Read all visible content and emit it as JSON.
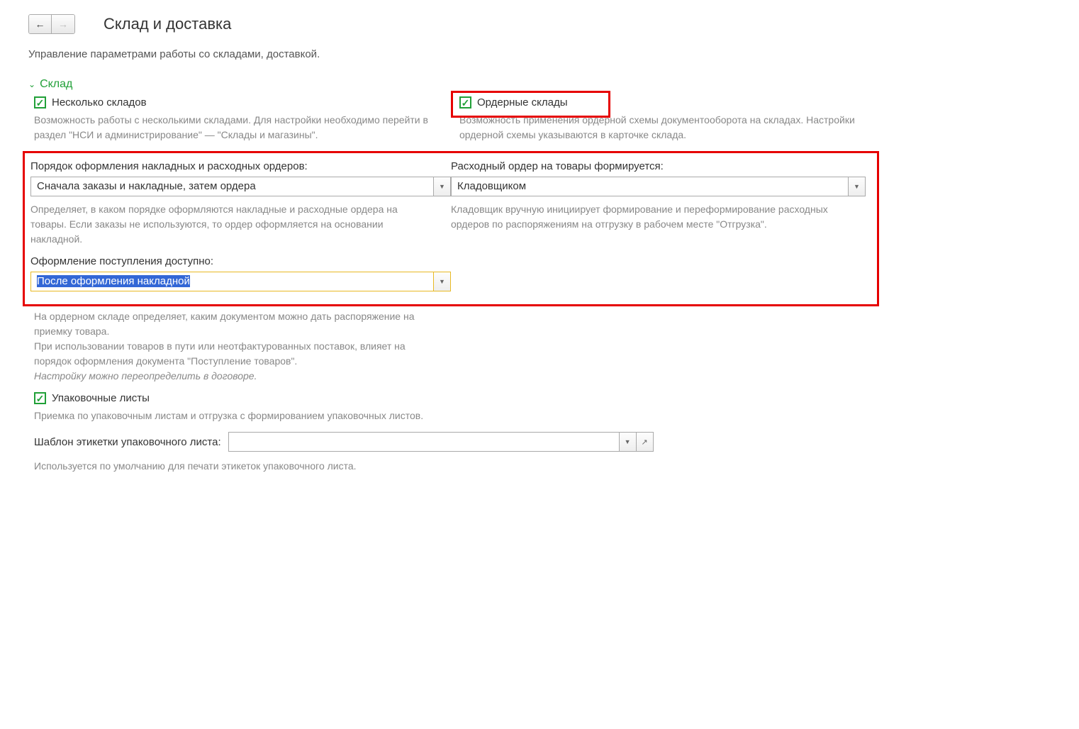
{
  "header": {
    "title": "Склад и доставка"
  },
  "subtitle": "Управление параметрами работы со складами, доставкой.",
  "section": {
    "title": "Склад"
  },
  "left": {
    "multiple_warehouses_label": "Несколько складов",
    "multiple_warehouses_desc": "Возможность работы с несколькими складами. Для настройки необходимо перейти в раздел \"НСИ и администрирование\" — \"Склады и магазины\"."
  },
  "right": {
    "order_warehouses_label": "Ордерные склады",
    "order_warehouses_desc": "Возможность применения ордерной схемы документооборота на складах. Настройки ордерной схемы указываются в карточке склада."
  },
  "block": {
    "field1_label": "Порядок оформления накладных и расходных ордеров:",
    "field1_value": "Сначала заказы и накладные, затем ордера",
    "field1_desc": "Определяет, в каком порядке оформляются накладные и расходные ордера на товары. Если заказы не используются, то ордер оформляется на основании накладной.",
    "field2_label": "Расходный ордер на товары формируется:",
    "field2_value": "Кладовщиком",
    "field2_desc": "Кладовщик вручную инициирует формирование и переформирование расходных ордеров по распоряжениям на отгрузку в рабочем месте \"Отгрузка\".",
    "field3_label": "Оформление поступления доступно:",
    "field3_value": "После оформления накладной"
  },
  "below": {
    "desc1": "На ордерном складе определяет, каким документом можно дать распоряжение на приемку товара.",
    "desc2": "При использовании товаров в пути или неотфактурованных поставок, влияет на порядок оформления документа \"Поступление товаров\".",
    "desc3_italic": "Настройку можно переопределить в договоре.",
    "packing_lists_label": "Упаковочные листы",
    "packing_lists_desc": "Приемка по упаковочным листам и отгрузка с формированием упаковочных листов.",
    "template_label": "Шаблон этикетки упаковочного листа:",
    "template_value": "",
    "template_desc": "Используется по умолчанию для печати этикеток упаковочного листа."
  }
}
